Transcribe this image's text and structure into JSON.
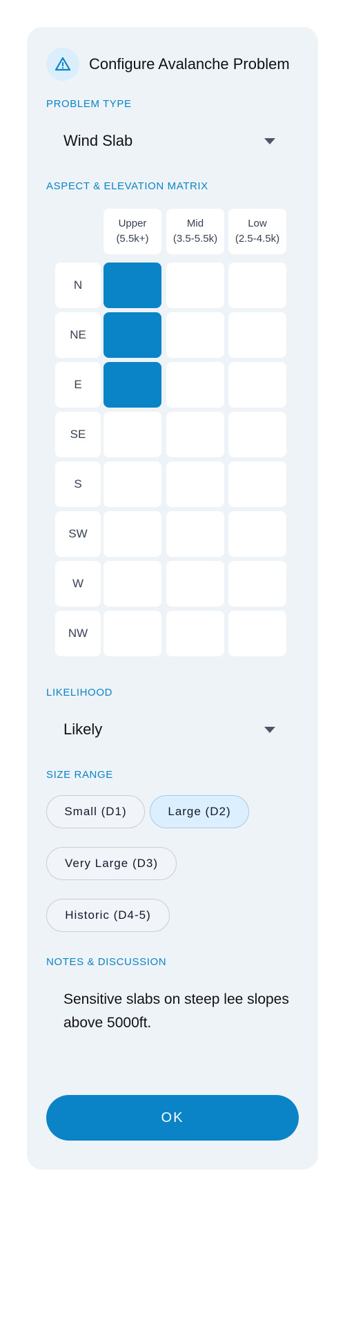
{
  "dialog": {
    "title": "Configure Avalanche Problem"
  },
  "problem_type": {
    "label": "PROBLEM TYPE",
    "value": "Wind Slab"
  },
  "matrix": {
    "label": "ASPECT & ELEVATION MATRIX",
    "columns": [
      {
        "name": "Upper",
        "range": "(5.5k+)"
      },
      {
        "name": "Mid",
        "range": "(3.5-5.5k)"
      },
      {
        "name": "Low",
        "range": "(2.5-4.5k)"
      }
    ],
    "rows": [
      "N",
      "NE",
      "E",
      "SE",
      "S",
      "SW",
      "W",
      "NW"
    ],
    "selected": [
      [
        true,
        false,
        false
      ],
      [
        true,
        false,
        false
      ],
      [
        true,
        false,
        false
      ],
      [
        false,
        false,
        false
      ],
      [
        false,
        false,
        false
      ],
      [
        false,
        false,
        false
      ],
      [
        false,
        false,
        false
      ],
      [
        false,
        false,
        false
      ]
    ]
  },
  "likelihood": {
    "label": "LIKELIHOOD",
    "value": "Likely"
  },
  "size_range": {
    "label": "SIZE RANGE",
    "options": [
      {
        "label": "Small (D1)",
        "selected": false
      },
      {
        "label": "Large (D2)",
        "selected": true
      },
      {
        "label": "Very Large (D3)",
        "selected": false
      },
      {
        "label": "Historic (D4-5)",
        "selected": false
      }
    ]
  },
  "notes": {
    "label": "NOTES & DISCUSSION",
    "value": "Sensitive slabs on steep lee slopes above 5000ft."
  },
  "ok_label": "OK",
  "colors": {
    "accent": "#0a84c6",
    "card_bg": "#eef3f8",
    "pill_active_bg": "#dcefff"
  }
}
